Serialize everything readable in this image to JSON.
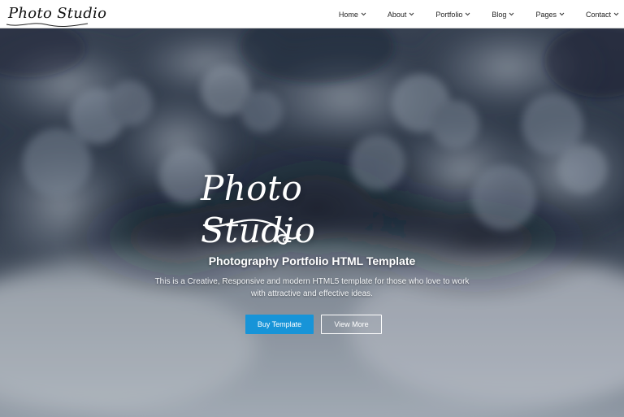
{
  "brand": {
    "name": "Photo Studio"
  },
  "nav": {
    "items": [
      {
        "label": "Home",
        "icon": "chevron-down-icon"
      },
      {
        "label": "About",
        "icon": "chevron-down-icon"
      },
      {
        "label": "Portfolio",
        "icon": "chevron-down-icon"
      },
      {
        "label": "Blog",
        "icon": "chevron-down-icon"
      },
      {
        "label": "Pages",
        "icon": "chevron-down-icon"
      },
      {
        "label": "Contact",
        "icon": "chevron-down-icon"
      }
    ]
  },
  "hero": {
    "script_logo": "Photo Studio",
    "title": "Photography Portfolio HTML Template",
    "description": "This is a Creative, Responsive and modern HTML5 template for those who love to work with attractive and effective ideas.",
    "buttons": {
      "primary": "Buy Template",
      "secondary": "View More"
    }
  },
  "colors": {
    "accent": "#1794d8",
    "nav_background": "#ffffff",
    "hero_dark": "#202b3a"
  }
}
